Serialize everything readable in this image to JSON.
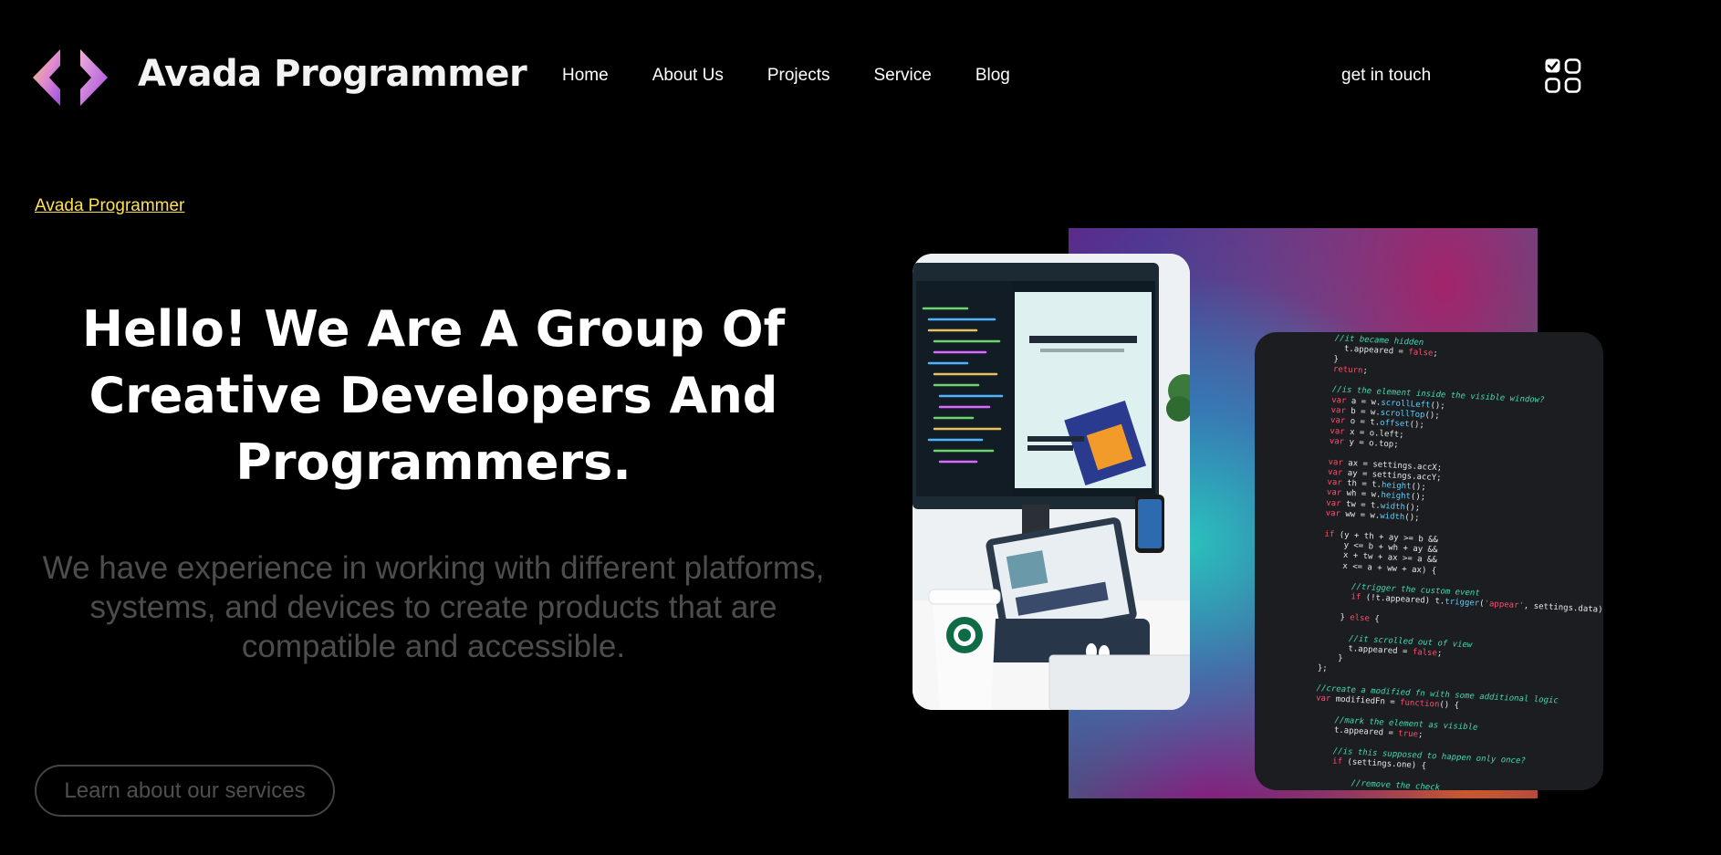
{
  "brand": {
    "name": "Avada Programmer",
    "logo_icon": "chevrons-logo-icon"
  },
  "nav": {
    "items": [
      "Home",
      "About Us",
      "Projects",
      "Service",
      "Blog"
    ],
    "cta": "get in touch",
    "menu_icon": "apps-grid-icon"
  },
  "breadcrumb": "Avada Programmer",
  "hero": {
    "title": "Hello! We Are A Group Of Creative Developers And Programmers.",
    "subtitle": "We have experience in working with different platforms, systems, and devices to create products that are compatible and accessible.",
    "button": "Learn about our services"
  },
  "colors": {
    "background": "#000000",
    "breadcrumb": "#ffe14d",
    "subtitle": "#4d4d4d",
    "logo_gradient_start": "#f6c46a",
    "logo_gradient_end": "#b04ee0"
  },
  "visuals": {
    "photo_icon": "workspace-photo-image",
    "code_icon": "code-screen-image"
  }
}
